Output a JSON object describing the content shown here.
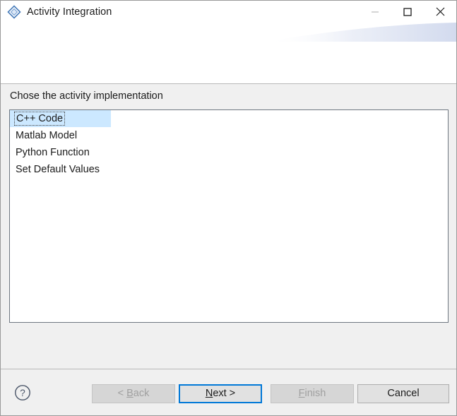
{
  "window": {
    "title": "Activity Integration",
    "icon": "diamond-shape-icon",
    "controls": {
      "minimize": "minimize",
      "maximize": "maximize",
      "close": "close"
    }
  },
  "content": {
    "prompt": "Chose the activity implementation",
    "list": {
      "items": [
        {
          "label": "C++ Code",
          "selected": true
        },
        {
          "label": "Matlab Model",
          "selected": false
        },
        {
          "label": "Python Function",
          "selected": false
        },
        {
          "label": "Set Default Values",
          "selected": false
        }
      ]
    }
  },
  "footer": {
    "help": "?",
    "buttons": [
      {
        "id": "back",
        "label": "< Back",
        "mnemonic": "B",
        "enabled": false,
        "default": false
      },
      {
        "id": "next",
        "label": "Next >",
        "mnemonic": "N",
        "enabled": true,
        "default": true
      },
      {
        "id": "finish",
        "label": "Finish",
        "mnemonic": "F",
        "enabled": false,
        "default": false
      },
      {
        "id": "cancel",
        "label": "Cancel",
        "mnemonic": "",
        "enabled": true,
        "default": false
      }
    ]
  },
  "colors": {
    "accent": "#0078d7",
    "selection": "#cce8ff",
    "dialog_background": "#f0f0f0",
    "list_background": "#ffffff",
    "text": "#1b1b1b",
    "disabled_text": "#a0a0a0",
    "border": "#6e7680",
    "swoosh": "#dde2f0"
  }
}
